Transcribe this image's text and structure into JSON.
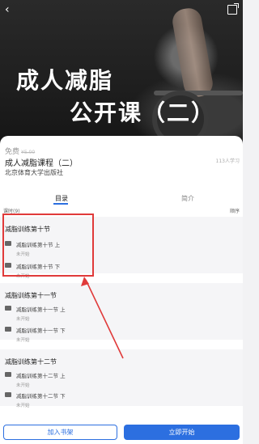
{
  "hero": {
    "title_line1": "成人减脂",
    "title_line2": "公开课（二）"
  },
  "course": {
    "price_label": "免费",
    "original_price": "¥5.00",
    "learners": "113人学习",
    "title": "成人减脂课程（二）",
    "publisher": "北京体育大学出版社"
  },
  "tabs": {
    "catalog": "目录",
    "intro": "简介"
  },
  "list": {
    "count": "课时(9)",
    "sort": "顺序"
  },
  "chapters": [
    {
      "title": "减脂训练第十节",
      "lessons": [
        {
          "name": "减脂训练第十节 上",
          "status": "未开始"
        },
        {
          "name": "减脂训练第十节 下",
          "status": "未开始"
        }
      ]
    },
    {
      "title": "减脂训练第十一节",
      "lessons": [
        {
          "name": "减脂训练第十一节 上",
          "status": "未开始"
        },
        {
          "name": "减脂训练第十一节 下",
          "status": "未开始"
        }
      ]
    },
    {
      "title": "减脂训练第十二节",
      "lessons": [
        {
          "name": "减脂训练第十二节 上",
          "status": "未开始"
        },
        {
          "name": "减脂训练第十二节 下",
          "status": "未开始"
        }
      ]
    }
  ],
  "buttons": {
    "add_to_shelf": "加入书架",
    "start_now": "立即开始"
  },
  "colors": {
    "accent": "#2c6fe0",
    "annotation": "#e03a3a"
  }
}
